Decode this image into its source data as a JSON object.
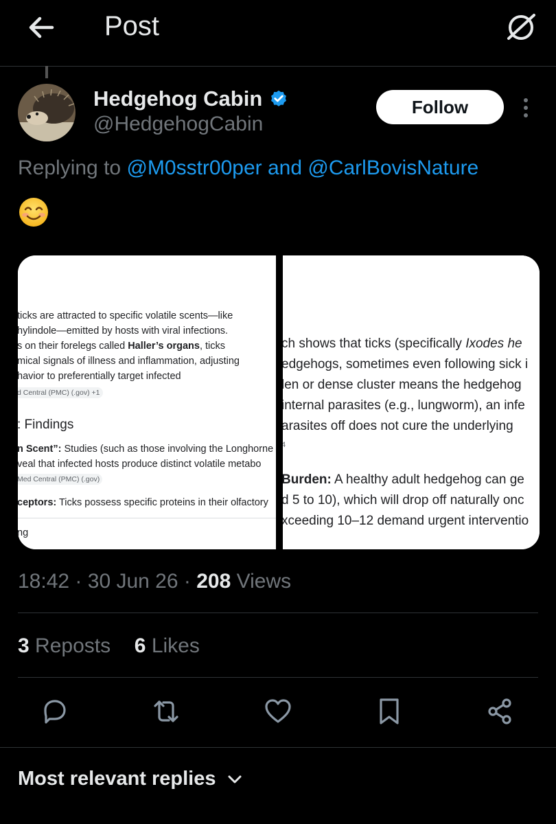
{
  "header": {
    "title": "Post",
    "back_icon": "arrow-left-icon",
    "grok_icon": "grok-icon"
  },
  "author": {
    "name": "Hedgehog Cabin",
    "handle": "@HedgehogCabin",
    "verified": true,
    "verified_color": "#1d9bf0"
  },
  "follow_label": "Follow",
  "replying": {
    "prefix": "Replying to",
    "mention1": "@M0sstr00per",
    "and": "and",
    "mention2": "@CarlBovisNature"
  },
  "emoji": "smiling-face-with-smiling-eyes",
  "image_left": {
    "lines": [
      "ticks are attracted to specific volatile scents—like",
      "hylindole—emitted by hosts with viral infections.",
      "s on their forelegs called ",
      "mical signals of illness and inflammation, adjusting",
      "havior to preferentially target infected"
    ],
    "bold_term": "Haller’s organs",
    "line3_suffix": ", ticks",
    "source1": "d Central (PMC) (.gov) +1",
    "heading": ": Findings",
    "scent_label": "n Scent”:",
    "scent_text": " Studies (such as those involving the Longhorne",
    "scent_line2": "veal that infected hosts produce distinct volatile metabo",
    "source2": "Med Central (PMC) (.gov)",
    "receptors_label": "ceptors:",
    "receptors_text": " Ticks possess specific proteins in their olfactory",
    "footer": "ng"
  },
  "image_right": {
    "line1_prefix": "ch shows that ticks (specifically ",
    "line1_italic": "Ixodes he",
    "line2": "edgehogs, sometimes even following sick i",
    "line3": "len or dense cluster means the hedgehog",
    "line4": "internal parasites (e.g., lungworm), an infe",
    "line5": "arasites off does not cure the underlying",
    "stray": "4",
    "burden_label": "Burden:",
    "burden_text": " A healthy adult hedgehog can ge",
    "line7": "d 5 to 10), which will drop off naturally onc",
    "line8": "xceeding 10–12 demand urgent interventio"
  },
  "meta": {
    "time": "18:42",
    "dot": "·",
    "date": "30 Jun 26",
    "views_count": "208",
    "views_label": "Views"
  },
  "stats": {
    "reposts_count": "3",
    "reposts_label": "Reposts",
    "likes_count": "6",
    "likes_label": "Likes"
  },
  "actions": [
    "reply-icon",
    "repost-icon",
    "like-icon",
    "bookmark-icon",
    "share-icon"
  ],
  "replies_sort": "Most relevant replies"
}
